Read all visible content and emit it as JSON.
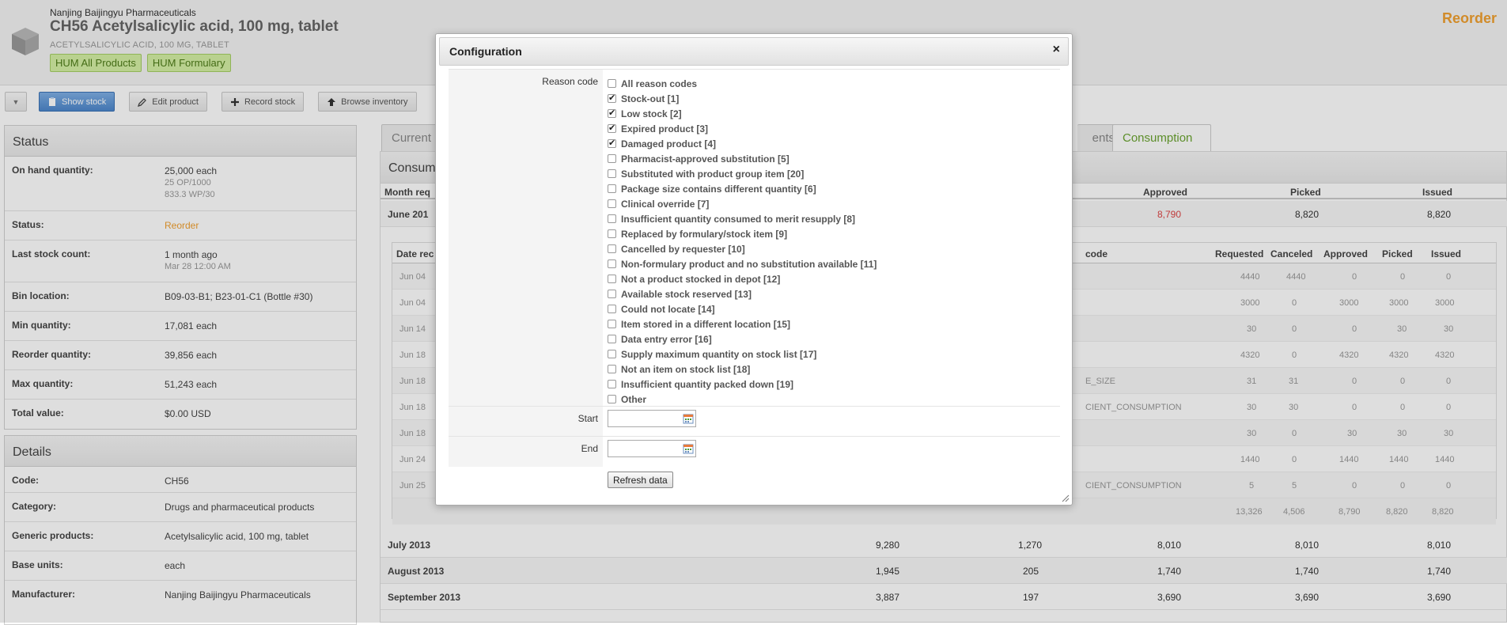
{
  "header": {
    "vendor": "Nanjing Baijingyu Pharmaceuticals",
    "title": "CH56 Acetylsalicylic acid, 100 mg, tablet",
    "subtitle": "ACETYLSALICYLIC ACID, 100 MG, TABLET",
    "tags": [
      "HUM All Products",
      "HUM Formulary"
    ],
    "status_flag": "Reorder"
  },
  "toolbar": {
    "show_stock": "Show stock",
    "edit_product": "Edit product",
    "record_stock": "Record stock",
    "browse_inventory": "Browse inventory"
  },
  "status_panel": {
    "title": "Status",
    "on_hand_label": "On hand quantity:",
    "on_hand_value": "25,000 each",
    "on_hand_sub1": "25 OP/1000",
    "on_hand_sub2": "833.3 WP/30",
    "status_label": "Status:",
    "status_value": "Reorder",
    "last_count_label": "Last stock count:",
    "last_count_value": "1 month ago",
    "last_count_sub": "Mar 28 12:00 AM",
    "bin_label": "Bin location:",
    "bin_value": "B09-03-B1; B23-01-C1 (Bottle #30)",
    "min_label": "Min quantity:",
    "min_value": "17,081 each",
    "reorder_label": "Reorder quantity:",
    "reorder_value": "39,856 each",
    "max_label": "Max quantity:",
    "max_value": "51,243 each",
    "total_label": "Total value:",
    "total_value": "$0.00 USD"
  },
  "details_panel": {
    "title": "Details",
    "code_label": "Code:",
    "code_value": "CH56",
    "category_label": "Category:",
    "category_value": "Drugs and pharmaceutical products",
    "generic_label": "Generic products:",
    "generic_value": "Acetylsalicylic acid, 100 mg, tablet",
    "base_label": "Base units:",
    "base_value": "each",
    "manufacturer_label": "Manufacturer:",
    "manufacturer_value": "Nanjing Baijingyu Pharmaceuticals"
  },
  "tabs": {
    "current": "Current",
    "ents": "ents",
    "consumption": "Consumption"
  },
  "consumption": {
    "title": "Consum",
    "headers": {
      "month": "Month req",
      "approved": "Approved",
      "picked": "Picked",
      "issued": "Issued"
    },
    "june_row": {
      "month": "June 201",
      "approved": "8,790",
      "picked": "8,820",
      "issued": "8,820"
    },
    "detail_headers": {
      "date": "Date rec",
      "code": "code",
      "requested": "Requested",
      "canceled": "Canceled",
      "approved": "Approved",
      "picked": "Picked",
      "issued": "Issued"
    },
    "detail_rows": [
      {
        "date": "Jun 04",
        "code": "",
        "requested": "4440",
        "canceled": "4440",
        "approved": "0",
        "picked": "0",
        "issued": "0"
      },
      {
        "date": "Jun 04",
        "code": "",
        "requested": "3000",
        "canceled": "0",
        "approved": "3000",
        "picked": "3000",
        "issued": "3000"
      },
      {
        "date": "Jun 14",
        "code": "",
        "requested": "30",
        "canceled": "0",
        "approved": "0",
        "picked": "30",
        "issued": "30"
      },
      {
        "date": "Jun 18",
        "code": "",
        "requested": "4320",
        "canceled": "0",
        "approved": "4320",
        "picked": "4320",
        "issued": "4320"
      },
      {
        "date": "Jun 18",
        "code": "E_SIZE",
        "requested": "31",
        "canceled": "31",
        "approved": "0",
        "picked": "0",
        "issued": "0"
      },
      {
        "date": "Jun 18",
        "code": "CIENT_CONSUMPTION",
        "requested": "30",
        "canceled": "30",
        "approved": "0",
        "picked": "0",
        "issued": "0"
      },
      {
        "date": "Jun 18",
        "code": "",
        "requested": "30",
        "canceled": "0",
        "approved": "30",
        "picked": "30",
        "issued": "30"
      },
      {
        "date": "Jun 24",
        "code": "",
        "requested": "1440",
        "canceled": "0",
        "approved": "1440",
        "picked": "1440",
        "issued": "1440"
      },
      {
        "date": "Jun 25",
        "code": "CIENT_CONSUMPTION",
        "requested": "5",
        "canceled": "5",
        "approved": "0",
        "picked": "0",
        "issued": "0"
      }
    ],
    "detail_total": {
      "requested": "13,326",
      "canceled": "4,506",
      "approved": "8,790",
      "picked": "8,820",
      "issued": "8,820"
    },
    "months": [
      {
        "month": "July 2013",
        "requested": "9,280",
        "canceled": "1,270",
        "approved": "8,010",
        "picked": "8,010",
        "issued": "8,010"
      },
      {
        "month": "August 2013",
        "requested": "1,945",
        "canceled": "205",
        "approved": "1,740",
        "picked": "1,740",
        "issued": "1,740"
      },
      {
        "month": "September 2013",
        "requested": "3,887",
        "canceled": "197",
        "approved": "3,690",
        "picked": "3,690",
        "issued": "3,690"
      }
    ]
  },
  "dialog": {
    "title": "Configuration",
    "close": "×",
    "reason_label": "Reason code",
    "reasons": [
      {
        "label": "All reason codes",
        "checked": false
      },
      {
        "label": "Stock-out [1]",
        "checked": true
      },
      {
        "label": "Low stock [2]",
        "checked": true
      },
      {
        "label": "Expired product [3]",
        "checked": true
      },
      {
        "label": "Damaged product [4]",
        "checked": true
      },
      {
        "label": "Pharmacist-approved substitution [5]",
        "checked": false
      },
      {
        "label": "Substituted with product group item [20]",
        "checked": false
      },
      {
        "label": "Package size contains different quantity [6]",
        "checked": false
      },
      {
        "label": "Clinical override [7]",
        "checked": false
      },
      {
        "label": "Insufficient quantity consumed to merit resupply [8]",
        "checked": false
      },
      {
        "label": "Replaced by formulary/stock item [9]",
        "checked": false
      },
      {
        "label": "Cancelled by requester [10]",
        "checked": false
      },
      {
        "label": "Non-formulary product and no substitution available [11]",
        "checked": false
      },
      {
        "label": "Not a product stocked in depot [12]",
        "checked": false
      },
      {
        "label": "Available stock reserved [13]",
        "checked": false
      },
      {
        "label": "Could not locate [14]",
        "checked": false
      },
      {
        "label": "Item stored in a different location [15]",
        "checked": false
      },
      {
        "label": "Data entry error [16]",
        "checked": false
      },
      {
        "label": "Supply maximum quantity on stock list [17]",
        "checked": false
      },
      {
        "label": "Not an item on stock list [18]",
        "checked": false
      },
      {
        "label": "Insufficient quantity packed down [19]",
        "checked": false
      },
      {
        "label": "Other",
        "checked": false
      }
    ],
    "start_label": "Start",
    "end_label": "End",
    "refresh": "Refresh data"
  }
}
